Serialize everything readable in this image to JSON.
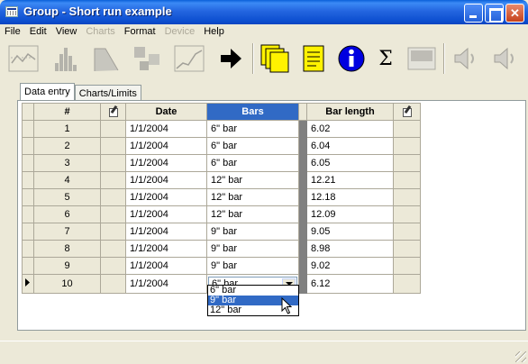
{
  "window": {
    "title": "Group - Short run example"
  },
  "menu": [
    {
      "label": "File",
      "enabled": true
    },
    {
      "label": "Edit",
      "enabled": true
    },
    {
      "label": "View",
      "enabled": true
    },
    {
      "label": "Charts",
      "enabled": false
    },
    {
      "label": "Format",
      "enabled": true
    },
    {
      "label": "Device",
      "enabled": false
    },
    {
      "label": "Help",
      "enabled": true
    }
  ],
  "toolbar": {
    "buttons": [
      {
        "icon": "chart-line-icon",
        "enabled": false
      },
      {
        "icon": "histogram-icon",
        "enabled": false
      },
      {
        "icon": "curve-icon",
        "enabled": false
      },
      {
        "icon": "scatter-icon",
        "enabled": false
      },
      {
        "icon": "trend-icon",
        "enabled": false
      },
      {
        "icon": "arrow-right-icon",
        "enabled": true
      },
      {
        "icon": "multi-pages-icon",
        "enabled": true
      },
      {
        "icon": "notepad-icon",
        "enabled": true
      },
      {
        "icon": "info-icon",
        "enabled": true
      },
      {
        "icon": "sigma-icon",
        "enabled": true,
        "label": "Σ"
      },
      {
        "icon": "device-icon",
        "enabled": false
      },
      {
        "icon": "speaker-icon",
        "enabled": false
      },
      {
        "icon": "speaker-icon-2",
        "enabled": false
      }
    ]
  },
  "tabs": [
    {
      "label": "Data entry",
      "active": true
    },
    {
      "label": "Charts/Limits",
      "active": false
    }
  ],
  "grid": {
    "columns": {
      "num": "#",
      "date": "Date",
      "bars": "Bars",
      "length": "Bar length"
    },
    "rows": [
      {
        "num": "1",
        "date": "1/1/2004",
        "bars": "6\" bar",
        "length": "6.02"
      },
      {
        "num": "2",
        "date": "1/1/2004",
        "bars": "6\" bar",
        "length": "6.04"
      },
      {
        "num": "3",
        "date": "1/1/2004",
        "bars": "6\" bar",
        "length": "6.05"
      },
      {
        "num": "4",
        "date": "1/1/2004",
        "bars": "12\" bar",
        "length": "12.21"
      },
      {
        "num": "5",
        "date": "1/1/2004",
        "bars": "12\" bar",
        "length": "12.18"
      },
      {
        "num": "6",
        "date": "1/1/2004",
        "bars": "12\" bar",
        "length": "12.09"
      },
      {
        "num": "7",
        "date": "1/1/2004",
        "bars": "9\" bar",
        "length": "9.05"
      },
      {
        "num": "8",
        "date": "1/1/2004",
        "bars": "9\" bar",
        "length": "8.98"
      },
      {
        "num": "9",
        "date": "1/1/2004",
        "bars": "9\" bar",
        "length": "9.02"
      },
      {
        "num": "10",
        "date": "1/1/2004",
        "bars": "6\" bar",
        "length": "6.12"
      }
    ]
  },
  "dropdown": {
    "options": [
      "6\" bar",
      "9\" bar",
      "12\" bar"
    ],
    "selected_index": 1
  },
  "colors": {
    "selection": "#316AC5",
    "titlebar": "#2466E0",
    "face": "#ECE9D8"
  }
}
